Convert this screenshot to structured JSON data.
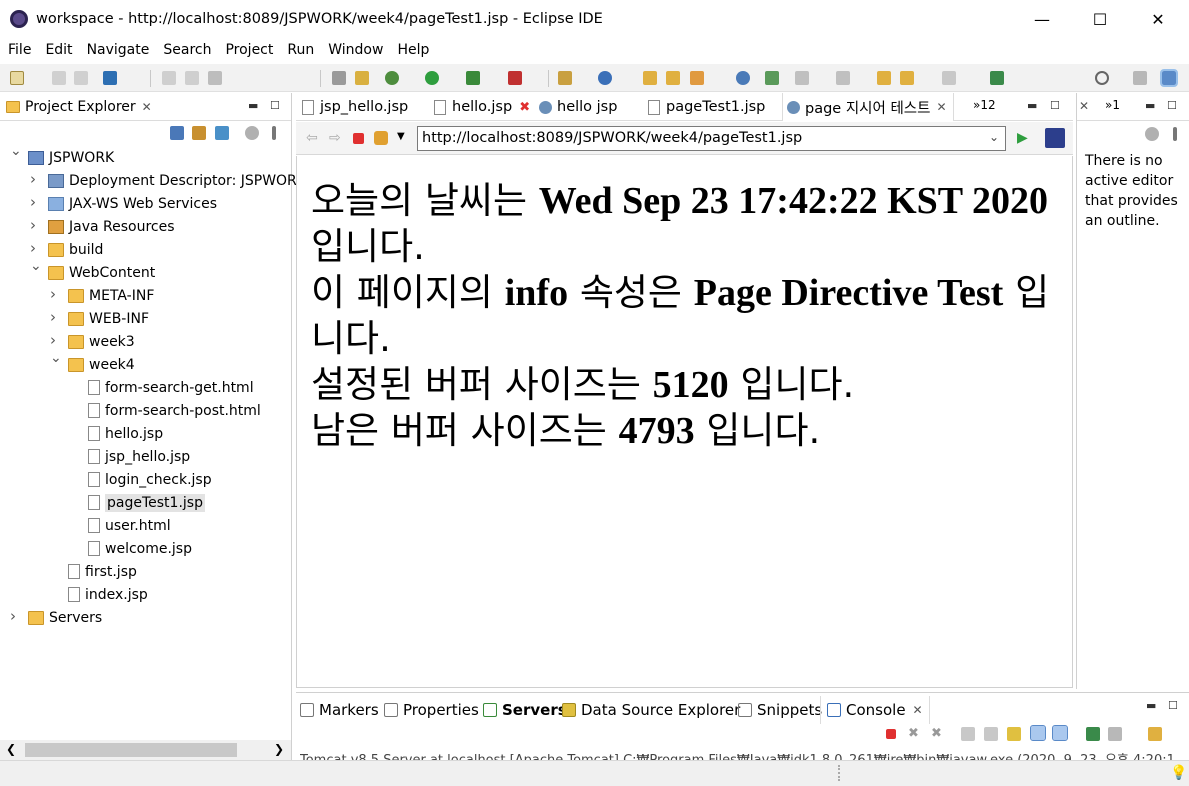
{
  "window": {
    "title": "workspace - http://localhost:8089/JSPWORK/week4/pageTest1.jsp - Eclipse IDE",
    "minimize": "—",
    "maximize": "☐",
    "close": "✕"
  },
  "menubar": [
    "File",
    "Edit",
    "Navigate",
    "Search",
    "Project",
    "Run",
    "Window",
    "Help"
  ],
  "project_explorer": {
    "tab_label": "Project Explorer",
    "tree": [
      {
        "label": "JSPWORK",
        "type": "project",
        "depth": 0,
        "expanded": true
      },
      {
        "label": "Deployment Descriptor: JSPWOR",
        "type": "dd",
        "depth": 1,
        "expanded": false
      },
      {
        "label": "JAX-WS Web Services",
        "type": "ws",
        "depth": 1,
        "expanded": false
      },
      {
        "label": "Java Resources",
        "type": "java",
        "depth": 1,
        "expanded": false
      },
      {
        "label": "build",
        "type": "folder",
        "depth": 1,
        "expanded": false
      },
      {
        "label": "WebContent",
        "type": "folder",
        "depth": 1,
        "expanded": true
      },
      {
        "label": "META-INF",
        "type": "folder",
        "depth": 2,
        "expanded": false
      },
      {
        "label": "WEB-INF",
        "type": "folder",
        "depth": 2,
        "expanded": false
      },
      {
        "label": "week3",
        "type": "folder",
        "depth": 2,
        "expanded": false
      },
      {
        "label": "week4",
        "type": "folder",
        "depth": 2,
        "expanded": true
      },
      {
        "label": "form-search-get.html",
        "type": "file",
        "depth": 3
      },
      {
        "label": "form-search-post.html",
        "type": "file",
        "depth": 3
      },
      {
        "label": "hello.jsp",
        "type": "file",
        "depth": 3
      },
      {
        "label": "jsp_hello.jsp",
        "type": "file",
        "depth": 3
      },
      {
        "label": "login_check.jsp",
        "type": "file",
        "depth": 3
      },
      {
        "label": "pageTest1.jsp",
        "type": "file",
        "depth": 3,
        "selected": true
      },
      {
        "label": "user.html",
        "type": "file",
        "depth": 3
      },
      {
        "label": "welcome.jsp",
        "type": "file",
        "depth": 3
      },
      {
        "label": "first.jsp",
        "type": "file",
        "depth": 2
      },
      {
        "label": "index.jsp",
        "type": "file",
        "depth": 2
      },
      {
        "label": "Servers",
        "type": "folder",
        "depth": 0,
        "expanded": false
      }
    ]
  },
  "editor": {
    "tabs": [
      {
        "label": "jsp_hello.jsp",
        "icon": "file-icon"
      },
      {
        "label": "hello.jsp",
        "icon": "file-icon",
        "close": "✖"
      },
      {
        "label": "hello jsp",
        "icon": "globe-icon"
      },
      {
        "label": "pageTest1.jsp",
        "icon": "file-icon"
      },
      {
        "label": "page 지시어 테스트",
        "icon": "globe-icon",
        "active": true,
        "close": "✕"
      }
    ],
    "overflow": "»12",
    "url": "http://localhost:8089/JSPWORK/week4/pageTest1.jsp"
  },
  "page": {
    "p1_pre": "오늘의 날씨는 ",
    "p1_bold": "Wed Sep 23 17:42:22 KST 2020",
    "p1_post": " 입니다.",
    "p2_pre": "이 페이지의 ",
    "p2_bold1": "info",
    "p2_mid": " 속성은 ",
    "p2_bold2": "Page Directive Test",
    "p2_post": " 입니다.",
    "p3_pre": "설정된 버퍼 사이즈는 ",
    "p3_bold": "5120",
    "p3_post": " 입니다.",
    "p4_pre": "남은 버퍼 사이즈는 ",
    "p4_bold": "4793",
    "p4_post": " 입니다."
  },
  "outline": {
    "tab_label": "»1",
    "message": "There is no active editor that provides an outline."
  },
  "bottom": {
    "tabs": [
      {
        "label": "Markers"
      },
      {
        "label": "Properties"
      },
      {
        "label": "Servers",
        "bold": true
      },
      {
        "label": "Data Source Explorer"
      },
      {
        "label": "Snippets"
      },
      {
        "label": "Console",
        "active": true
      }
    ],
    "console_line": "Tomcat v8.5 Server at localhost [Apache Tomcat] C:₩Program Files₩Java₩jdk1.8.0_261₩jre₩bin₩javaw.exe (2020. 9. 23. 오후 4:20:1"
  },
  "colors": {
    "accent": "#0078d7",
    "selection": "#e3e3e3",
    "error_red": "#e03030",
    "run_green": "#2e9e3e"
  }
}
